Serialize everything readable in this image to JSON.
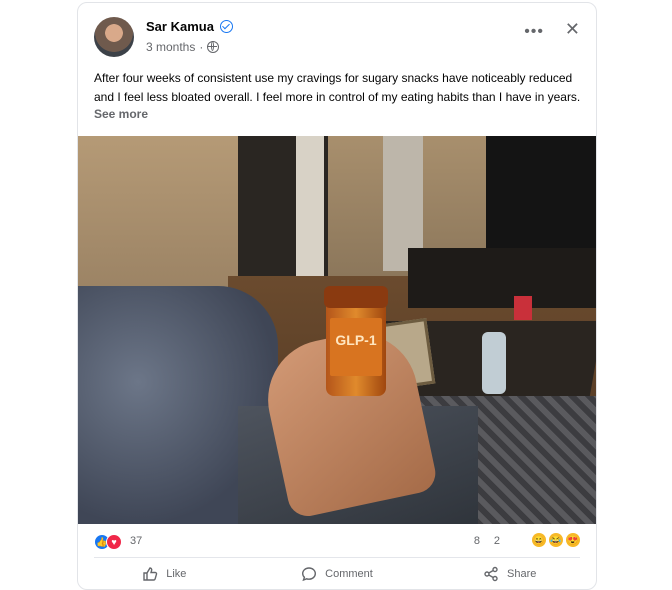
{
  "post": {
    "author": "Sar Kamua",
    "time": "3 months",
    "separator": "·",
    "text": "After four weeks of consistent use my cravings for sugary snacks have noticeably reduced and I feel less bloated overall. I feel more in control of my eating habits than I have in years.",
    "see_more": "See more",
    "more_glyph": "•••",
    "close_glyph": "✕"
  },
  "photo": {
    "bottle_title": "GLP-1"
  },
  "stats": {
    "reactions": "37",
    "comments": "8",
    "shares": "2",
    "react1_glyph": "👍",
    "react2_glyph": "♥",
    "emoji_right": [
      "😄",
      "😂",
      "😍"
    ]
  },
  "actions": {
    "like": "Like",
    "comment": "Comment",
    "share": "Share"
  },
  "colors": {
    "accent": "#1877f2",
    "love": "#f02849",
    "muted": "#65676b"
  }
}
